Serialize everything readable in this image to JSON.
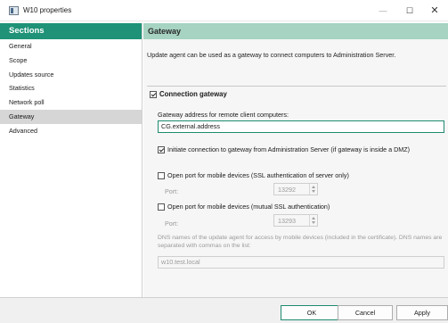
{
  "window": {
    "title": "W10 properties",
    "icon": "properties-window-icon",
    "minimize": "—",
    "maximize": "☐",
    "close": "✕"
  },
  "sidebar": {
    "header": "Sections",
    "items": [
      {
        "label": "General",
        "active": false
      },
      {
        "label": "Scope",
        "active": false
      },
      {
        "label": "Updates source",
        "active": false
      },
      {
        "label": "Statistics",
        "active": false
      },
      {
        "label": "Network poll",
        "active": false
      },
      {
        "label": "Gateway",
        "active": true
      },
      {
        "label": "Advanced",
        "active": false
      }
    ]
  },
  "main": {
    "header": "Gateway",
    "description": "Update agent can be used as a gateway to connect computers to Administration Server.",
    "connection_gateway": {
      "label": "Connection gateway",
      "checked": true
    },
    "gateway_address": {
      "label": "Gateway address for remote client computers:",
      "value": "CG.external.address"
    },
    "initiate_connection": {
      "label": "Initiate connection to gateway from Administration Server (if gateway is inside a DMZ)",
      "checked": true
    },
    "port_ssl_server": {
      "label": "Open port for mobile devices (SSL authentication of server only)",
      "checked": false,
      "port_label": "Port:",
      "port_value": "13292"
    },
    "port_mutual_ssl": {
      "label": "Open port for mobile devices (mutual SSL authentication)",
      "checked": false,
      "port_label": "Port:",
      "port_value": "13293"
    },
    "dns_note": "DNS names of the update agent for access by mobile devices (included in the certificate). DNS names are separated with commas on the list:",
    "dns_value": "w10.test.local"
  },
  "footer": {
    "ok": "OK",
    "cancel": "Cancel",
    "apply": "Apply"
  },
  "colors": {
    "sidebar_header": "#1f9277",
    "main_header": "#a6d3c2",
    "accent": "#1f8a70"
  }
}
